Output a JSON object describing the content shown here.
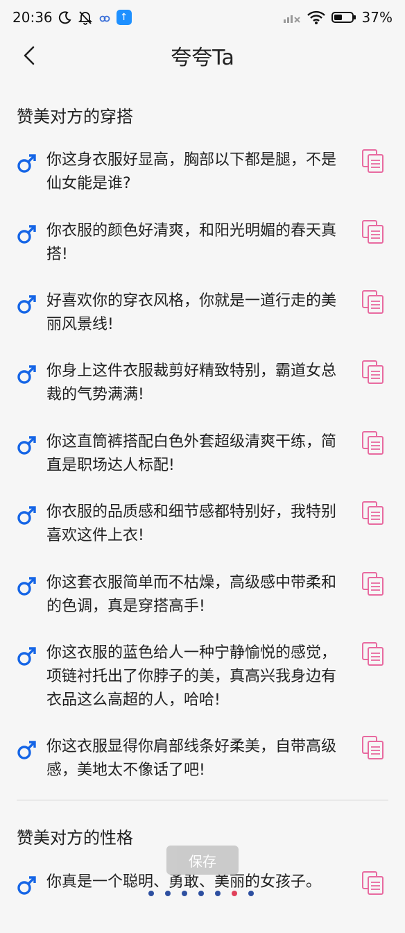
{
  "status_bar": {
    "time": "20:36",
    "battery": "37%",
    "colors": {
      "app_icon": "#1e90ff"
    }
  },
  "header": {
    "title": "夸夸Ta",
    "back_icon": "chevron-left-icon"
  },
  "sections": [
    {
      "title": "赞美对方的穿搭",
      "items": [
        "你这身衣服好显高，胸部以下都是腿，不是仙女能是谁?",
        "你衣服的颜色好清爽，和阳光明媚的春天真搭!",
        "好喜欢你的穿衣风格，你就是一道行走的美丽风景线!",
        "你身上这件衣服裁剪好精致特别，霸道女总裁的气势满满!",
        "你这直筒裤搭配白色外套超级清爽干练，简直是职场达人标配!",
        "你衣服的品质感和细节感都特别好，我特别喜欢这件上衣!",
        "你这套衣服简单而不枯燥，高级感中带柔和的色调，真是穿搭高手!",
        "你这衣服的蓝色给人一种宁静愉悦的感觉，项链衬托出了你脖子的美，真高兴我身边有衣品这么高超的人，哈哈!",
        "你这衣服显得你肩部线条好柔美，自带高级感，美地太不像话了吧!"
      ]
    },
    {
      "title": "赞美对方的性格",
      "items": [
        "你真是一个聪明、勇敢、美丽的女孩子。"
      ]
    }
  ],
  "save_button": {
    "label": "保存"
  },
  "pager": {
    "count": 7,
    "active_index": 5
  },
  "colors": {
    "male_icon": "#1565e6",
    "copy_icon": "#e86aa0",
    "dot": "#2d4fa0",
    "dot_active": "#e0405a"
  }
}
